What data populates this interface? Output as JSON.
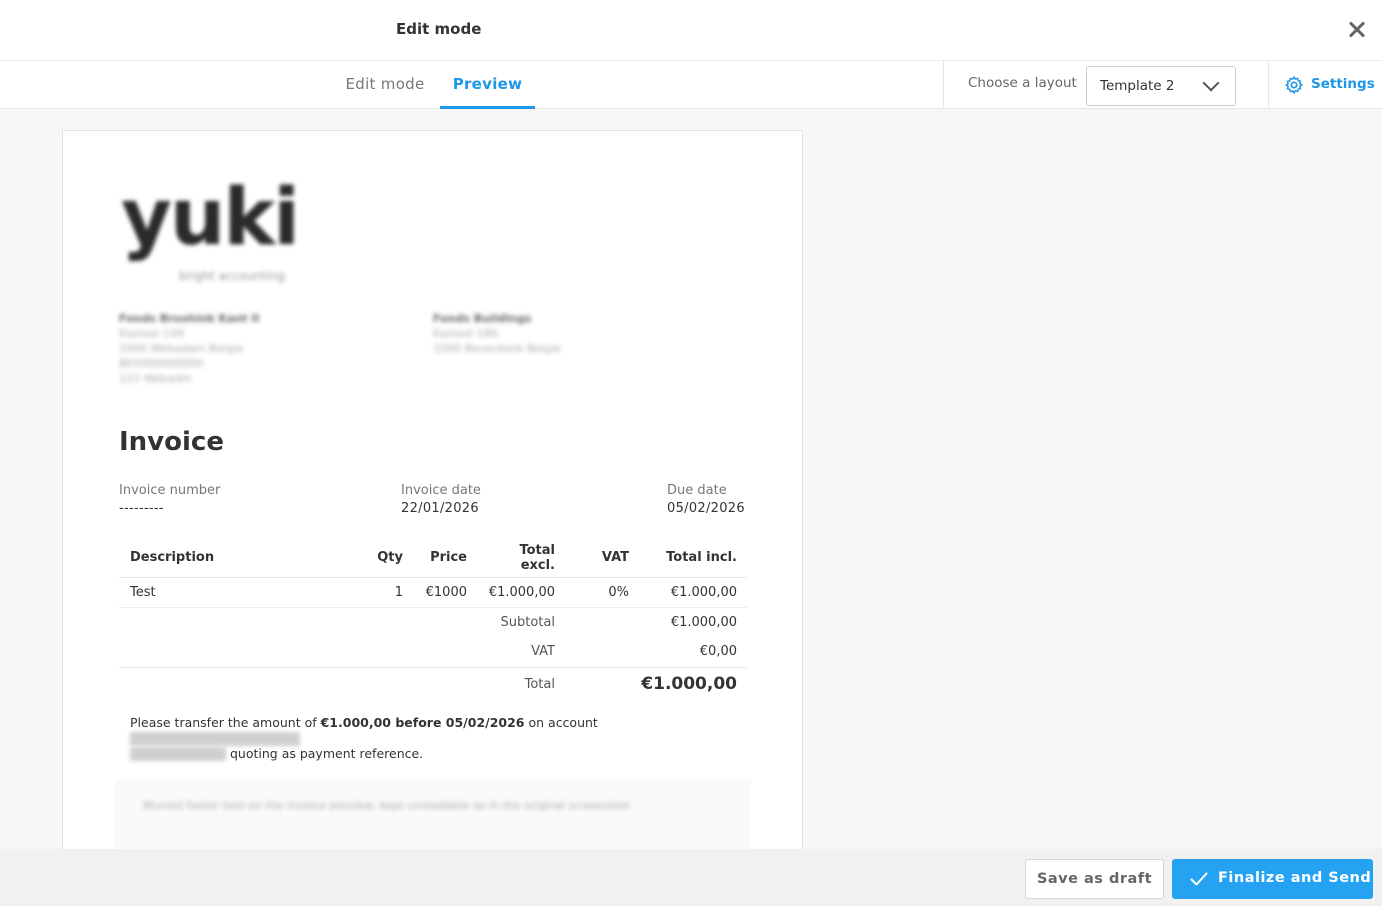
{
  "header": {
    "title": "Edit mode"
  },
  "tabs": [
    {
      "label": "Edit mode",
      "active": false
    },
    {
      "label": "Preview",
      "active": true
    }
  ],
  "layout": {
    "label": "Choose a layout",
    "selected": "Template 2"
  },
  "settings": {
    "label": "Settings"
  },
  "colors": {
    "accent": "#1d97e6",
    "primary_button": "#25a3f2"
  },
  "invoice": {
    "logo": {
      "text": "yuki",
      "tagline": "bright accounting"
    },
    "sender": [
      "Fonds Brushink Kant II",
      "Kasteel 148",
      "1000 Webadam Belgie",
      "BE0000000000",
      "123 Webadm"
    ],
    "recipient": [
      "Fonds Buildings",
      "Kasteel 186",
      "1000 Beverdonk Belgie"
    ],
    "title": "Invoice",
    "meta": [
      {
        "label": "Invoice number",
        "value": "---------"
      },
      {
        "label": "Invoice date",
        "value": "22/01/2026"
      },
      {
        "label": "Due date",
        "value": "05/02/2026"
      }
    ],
    "columns": [
      "Description",
      "Qty",
      "Price",
      "Total excl.",
      "VAT",
      "Total incl."
    ],
    "rows": [
      [
        "Test",
        "1",
        "€1000",
        "€1.000,00",
        "0%",
        "€1.000,00"
      ]
    ],
    "subtotal": {
      "label": "Subtotal",
      "value": "€1.000,00"
    },
    "vat": {
      "label": "VAT",
      "value": "€0,00"
    },
    "total": {
      "label": "Total",
      "value": "€1.000,00"
    },
    "payment": {
      "prefix": "Please transfer the amount of",
      "amount_due": "€1.000,00 before 05/02/2026",
      "middle": "on account",
      "suffix": "quoting as payment reference."
    },
    "footer_note": "Blurred footer text on the invoice preview, kept unreadable as in the original screenshot."
  },
  "actions": {
    "draft": "Save as draft",
    "send": "Finalize and Send"
  }
}
